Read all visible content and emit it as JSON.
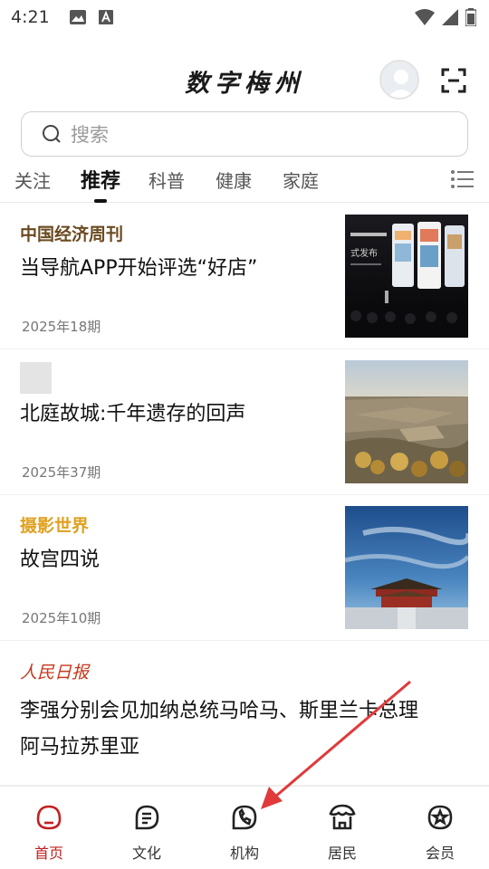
{
  "status_bar": {
    "time": "4:21"
  },
  "header": {
    "title": "数字梅州"
  },
  "search": {
    "placeholder": "搜索"
  },
  "tabs": [
    {
      "label": "关注"
    },
    {
      "label": "推荐"
    },
    {
      "label": "科普"
    },
    {
      "label": "健康"
    },
    {
      "label": "家庭"
    }
  ],
  "feed": [
    {
      "source": "中国经济周刊",
      "source_color": "#6b4a1f",
      "title": "当导航APP开始评选“好店”",
      "date": "2025年18期",
      "thumb_lines": [
        "式发布"
      ]
    },
    {
      "source": "",
      "title": "北庭故城:千年遗存的回声",
      "date": "2025年37期"
    },
    {
      "source": "摄影世界",
      "source_color": "#e0a020",
      "title": "故宫四说",
      "date": "2025年10期"
    },
    {
      "source": "人民日报",
      "source_color": "#c8371d",
      "title_line1": "李强分别会见加纳总统马哈马、斯里兰卡总理",
      "title_line2": "阿马拉苏里亚"
    }
  ],
  "bottom_nav": [
    {
      "label": "首页",
      "icon": "home-icon"
    },
    {
      "label": "文化",
      "icon": "document-icon"
    },
    {
      "label": "机构",
      "icon": "phone-icon"
    },
    {
      "label": "居民",
      "icon": "resident-icon"
    },
    {
      "label": "会员",
      "icon": "star-badge-icon"
    }
  ],
  "colors": {
    "accent": "#c21f1f",
    "annotation_arrow": "#e03a3a"
  }
}
